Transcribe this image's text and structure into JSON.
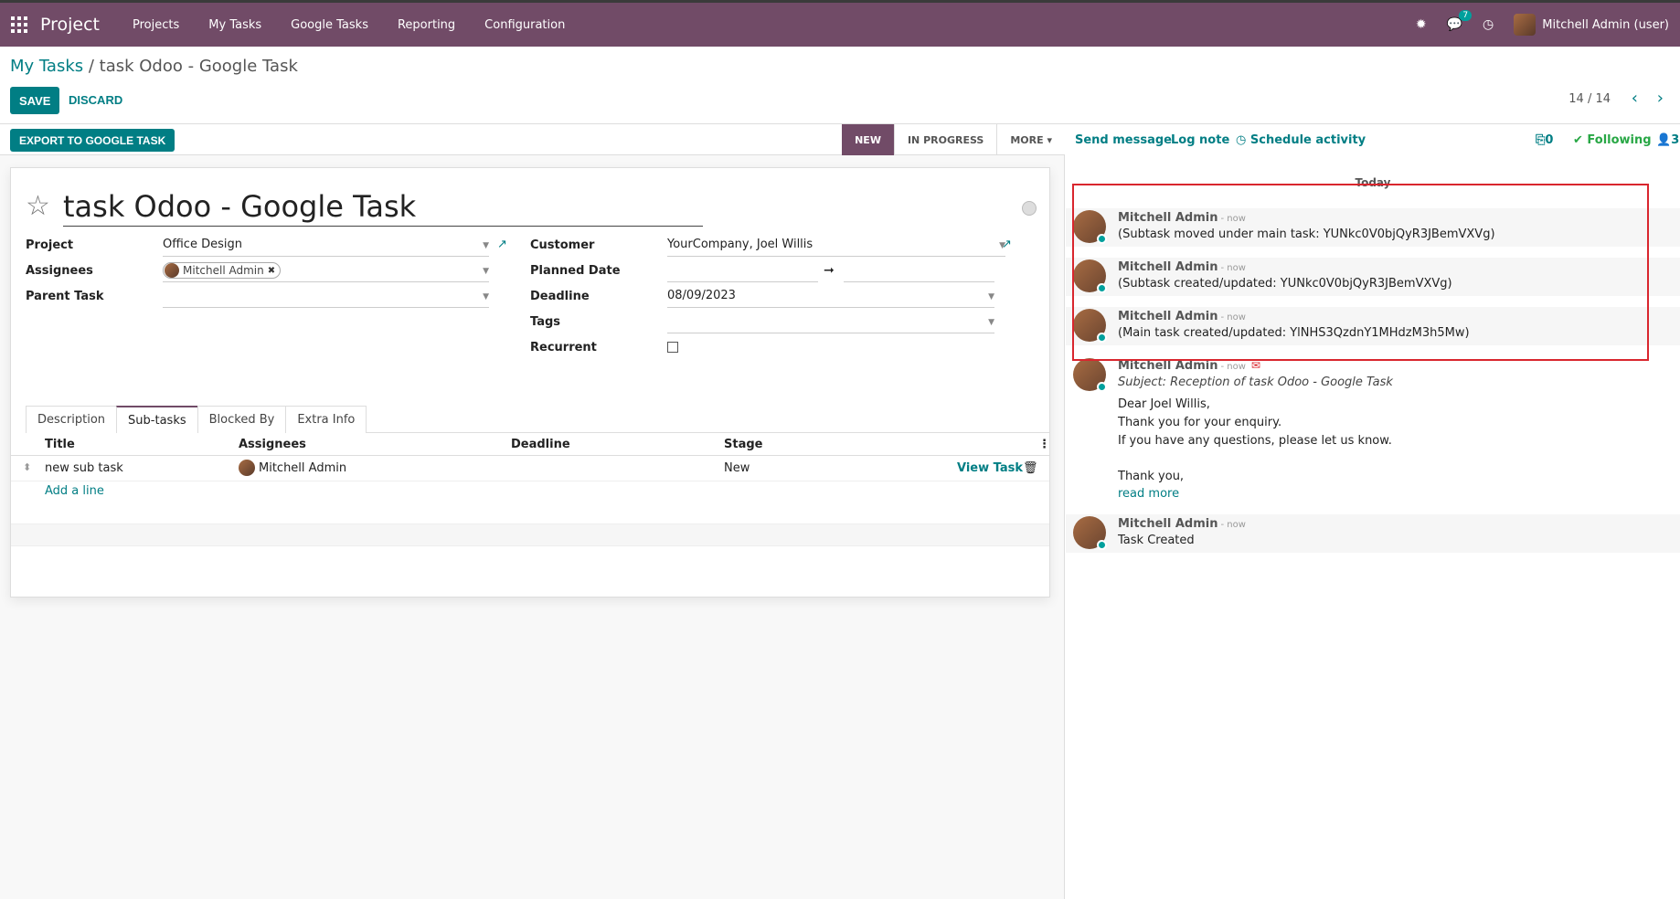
{
  "navbar": {
    "brand": "Project",
    "items": [
      "Projects",
      "My Tasks",
      "Google Tasks",
      "Reporting",
      "Configuration"
    ],
    "message_count": "7",
    "user": "Mitchell Admin (user)"
  },
  "control_panel": {
    "breadcrumb_parent": "My Tasks",
    "breadcrumb_sep": " / ",
    "breadcrumb_current": "task Odoo - Google Task",
    "save_label": "SAVE",
    "discard_label": "DISCARD",
    "pager": "14 / 14"
  },
  "statusbar": {
    "export_label": "EXPORT TO GOOGLE TASK",
    "stages": [
      "NEW",
      "IN PROGRESS",
      "MORE"
    ]
  },
  "form": {
    "title": "task Odoo - Google Task",
    "labels": {
      "project": "Project",
      "assignees": "Assignees",
      "parent_task": "Parent Task",
      "customer": "Customer",
      "planned_date": "Planned Date",
      "deadline": "Deadline",
      "tags": "Tags",
      "recurrent": "Recurrent"
    },
    "values": {
      "project": "Office Design",
      "assignee": "Mitchell Admin",
      "customer": "YourCompany, Joel Willis",
      "deadline": "08/09/2023",
      "planned_arrow": "➞"
    },
    "tabs": [
      "Description",
      "Sub-tasks",
      "Blocked By",
      "Extra Info"
    ],
    "list": {
      "columns": [
        "Title",
        "Assignees",
        "Deadline",
        "Stage"
      ],
      "rows": [
        {
          "title": "new sub task",
          "assignee": "Mitchell Admin",
          "deadline": "",
          "stage": "New",
          "action": "View Task"
        }
      ],
      "add_line": "Add a line"
    }
  },
  "chatter": {
    "send_message": "Send message",
    "log_note": "Log note",
    "schedule_activity": "Schedule activity",
    "attachments": "0",
    "following": "Following",
    "followers": "3",
    "date_separator": "Today",
    "messages": [
      {
        "author": "Mitchell Admin",
        "when": "- now",
        "lines": [
          "(Subtask moved under main task: YUNkc0V0bjQyR3JBemVXVg)"
        ]
      },
      {
        "author": "Mitchell Admin",
        "when": "- now",
        "lines": [
          "(Subtask created/updated: YUNkc0V0bjQyR3JBemVXVg)"
        ]
      },
      {
        "author": "Mitchell Admin",
        "when": "- now",
        "lines": [
          "(Main task created/updated: YlNHS3QzdnY1MHdzM3h5Mw)"
        ]
      },
      {
        "author": "Mitchell Admin",
        "when": "- now",
        "subject": "Subject: Reception of task Odoo - Google Task",
        "lines": [
          "Dear Joel Willis,",
          "Thank you for your enquiry.",
          "If you have any questions, please let us know.",
          "",
          "Thank you,"
        ],
        "read_more": "read more"
      },
      {
        "author": "Mitchell Admin",
        "when": "- now",
        "lines": [
          "Task Created"
        ]
      }
    ]
  }
}
